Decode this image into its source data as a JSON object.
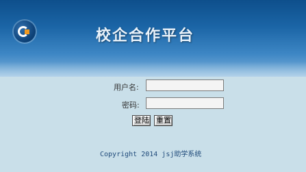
{
  "header": {
    "title": "校企合作平台"
  },
  "login_form": {
    "username_label": "用户名:",
    "username_value": "",
    "password_label": "密码:",
    "password_value": "",
    "login_button": "登陆",
    "reset_button": "重置"
  },
  "footer": {
    "copyright": "Copyright 2014 jsj助学系统"
  },
  "colors": {
    "banner_top": "#0e4f8c",
    "banner_bottom": "#7fb2dc",
    "background": "#c9dfe9",
    "footer_text": "#1f4a7a"
  },
  "icons": {
    "logo": "logo-icon"
  }
}
